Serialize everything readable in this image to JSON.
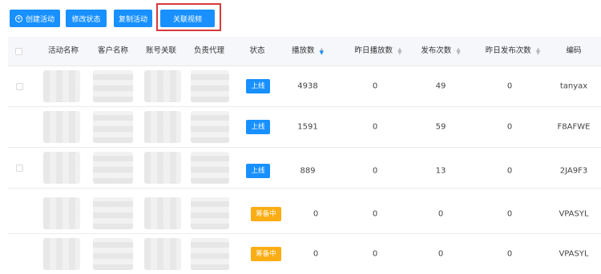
{
  "toolbar": {
    "create_label": "创建活动",
    "modify_label": "修改状态",
    "copy_label": "复制活动",
    "link_label": "关联视频",
    "accent": "#1890ff",
    "highlight_color": "#d63a3a"
  },
  "table": {
    "headers": {
      "name": "活动名称",
      "customer": "客户名称",
      "account": "账号关联",
      "agent": "负责代理",
      "status": "状态",
      "plays": "播放数",
      "yesterday_plays": "昨日播放数",
      "publish": "发布次数",
      "yesterday_publish": "昨日发布次数",
      "code": "编码"
    },
    "rows": [
      {
        "status": "上线",
        "status_color": "#1890ff",
        "plays": "4938",
        "yesterday_plays": "0",
        "publish": "49",
        "yesterday_publish": "0",
        "code": "tanyax"
      },
      {
        "status": "上线",
        "status_color": "#1890ff",
        "plays": "1591",
        "yesterday_plays": "0",
        "publish": "59",
        "yesterday_publish": "0",
        "code": "F8AFWE"
      },
      {
        "status": "上线",
        "status_color": "#1890ff",
        "plays": "889",
        "yesterday_plays": "0",
        "publish": "13",
        "yesterday_publish": "0",
        "code": "2JA9F3"
      },
      {
        "status": "筹备中",
        "status_color": "#faad14",
        "plays": "0",
        "yesterday_plays": "0",
        "publish": "0",
        "yesterday_publish": "0",
        "code": "VPASYL"
      },
      {
        "status": "筹备中",
        "status_color": "#faad14",
        "plays": "0",
        "yesterday_plays": "0",
        "publish": "0",
        "yesterday_publish": "0",
        "code": "VPASYL"
      }
    ]
  }
}
